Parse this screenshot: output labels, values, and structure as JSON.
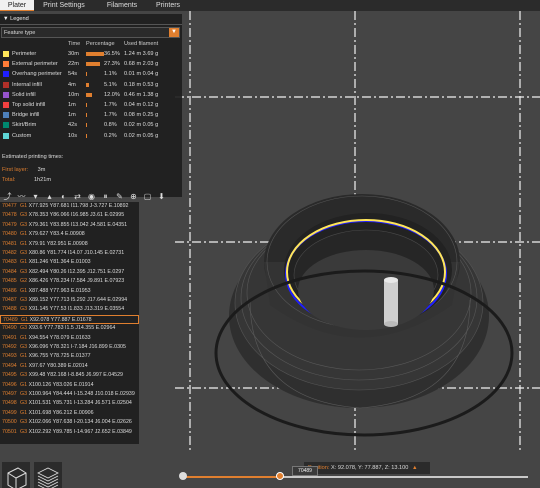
{
  "tabs": [
    {
      "label": "Plater",
      "active": true
    },
    {
      "label": "Print Settings",
      "active": false
    },
    {
      "label": "Filaments",
      "active": false
    },
    {
      "label": "Printers",
      "active": false
    }
  ],
  "legend": {
    "title": "Legend",
    "feature_select": "Feature type",
    "headers": {
      "time": "Time",
      "percentage": "Percentage",
      "used_filament": "Used filament"
    },
    "rows": [
      {
        "name": "Perimeter",
        "color": "#ffe65a",
        "time": "30m",
        "pct_value": 36.5,
        "pct": "36.5%",
        "filament": "1.24 m  3.69 g"
      },
      {
        "name": "External perimeter",
        "color": "#ff7d38",
        "time": "22m",
        "pct_value": 27.3,
        "pct": "27.3%",
        "filament": "0.68 m  2.03 g"
      },
      {
        "name": "Overhang perimeter",
        "color": "#1f1fff",
        "time": "54s",
        "pct_value": 1.1,
        "pct": "1.1%",
        "filament": "0.01 m  0.04 g"
      },
      {
        "name": "Internal infill",
        "color": "#b03029",
        "time": "4m",
        "pct_value": 5.1,
        "pct": "5.1%",
        "filament": "0.18 m  0.53 g"
      },
      {
        "name": "Solid infill",
        "color": "#9654cc",
        "time": "10m",
        "pct_value": 12.0,
        "pct": "12.0%",
        "filament": "0.46 m  1.38 g"
      },
      {
        "name": "Top solid infill",
        "color": "#f04040",
        "time": "1m",
        "pct_value": 1.7,
        "pct": "1.7%",
        "filament": "0.04 m  0.12 g"
      },
      {
        "name": "Bridge infill",
        "color": "#4d80ba",
        "time": "1m",
        "pct_value": 1.7,
        "pct": "1.7%",
        "filament": "0.08 m  0.25 g"
      },
      {
        "name": "Skirt/Brim",
        "color": "#00876e",
        "time": "42s",
        "pct_value": 0.8,
        "pct": "0.8%",
        "filament": "0.02 m  0.05 g"
      },
      {
        "name": "Custom",
        "color": "#5ed6d6",
        "time": "10s",
        "pct_value": 0.2,
        "pct": "0.2%",
        "filament": "0.02 m  0.05 g"
      }
    ],
    "estimated_title": "Estimated printing times:",
    "first_layer_label": "First layer:",
    "first_layer_value": "3m",
    "total_label": "Total:",
    "total_value": "1h21m"
  },
  "toolbar_icons": [
    "travel-icon",
    "wipe-icon",
    "retraction-icon",
    "deretraction-icon",
    "seams-icon",
    "tool-change-icon",
    "color-change-icon",
    "pause-icon",
    "custom-gcode-icon",
    "center-of-gravity-icon",
    "shells-icon",
    "tool-marker-icon"
  ],
  "gcode": [
    {
      "ln": "70477",
      "op": "G1",
      "tx": "X77.925 Y87.681 I11.798 J-3.727 E.10892"
    },
    {
      "ln": "70478",
      "op": "G3",
      "tx": "X78.353 Y86.066 I16.985 J3.61 E.02995"
    },
    {
      "ln": "70479",
      "op": "G3",
      "tx": "X79.361 Y83.855 I13.042 J4.581 E.04351"
    },
    {
      "ln": "70480",
      "op": "G1",
      "tx": "X79.627 Y83.4 E.00908"
    },
    {
      "ln": "70481",
      "op": "G1",
      "tx": "X79.91 Y82.951 E.00908"
    },
    {
      "ln": "70482",
      "op": "G3",
      "tx": "X80.86 Y81.774 I14.07 J10.145 E.02731"
    },
    {
      "ln": "70483",
      "op": "G1",
      "tx": "X81.246 Y81.364 E.01003"
    },
    {
      "ln": "70484",
      "op": "G3",
      "tx": "X82.494 Y80.26 I12.395 J12.751 E.0297"
    },
    {
      "ln": "70485",
      "op": "G2",
      "tx": "X86.426 Y78.234 I7.584 J9.891 E.07923"
    },
    {
      "ln": "70486",
      "op": "G1",
      "tx": "X87.488 Y77.963 E.01953"
    },
    {
      "ln": "70487",
      "op": "G3",
      "tx": "X89.152 Y77.713 I5.292 J17.644 E.02994"
    },
    {
      "ln": "70488",
      "op": "G3",
      "tx": "X91.145 Y77.53 I1.833 J13.319 E.03554"
    },
    {
      "ln": "70489",
      "op": "G1",
      "tx": "X92.078 Y77.887 E.01678",
      "sel": true
    },
    {
      "ln": "70490",
      "op": "G3",
      "tx": "X93.6 Y77.783 I1.5 J14.355 E.02964"
    },
    {
      "ln": "70491",
      "op": "G1",
      "tx": "X94.554 Y78.079 E.01633"
    },
    {
      "ln": "70492",
      "op": "G3",
      "tx": "X96.096 Y78.321 I-7.184 J16.899 E.0305"
    },
    {
      "ln": "70493",
      "op": "G1",
      "tx": "X96.755 Y78.725 E.01377"
    },
    {
      "ln": "70494",
      "op": "G1",
      "tx": "X97.67 Y80.389 E.02014"
    },
    {
      "ln": "70495",
      "op": "G3",
      "tx": "X99.48 Y82.168 I-8.845 J6.997 E.04529"
    },
    {
      "ln": "70496",
      "op": "G1",
      "tx": "X100.126 Y83.026 E.01914"
    },
    {
      "ln": "70497",
      "op": "G3",
      "tx": "X100.964 Y84.444 I-15.248 J10.018 E.02939"
    },
    {
      "ln": "70498",
      "op": "G3",
      "tx": "X101.531 Y85.731 I-13.284 J6.571 E.02504"
    },
    {
      "ln": "70499",
      "op": "G1",
      "tx": "X101.698 Y86.212 E.00906"
    },
    {
      "ln": "70500",
      "op": "G3",
      "tx": "X102.066 Y87.638 I-20.134 J6.004 E.02626"
    },
    {
      "ln": "70501",
      "op": "G3",
      "tx": "X102.292 Y89.785 I-14.967 J2.652 E.03849"
    }
  ],
  "position": {
    "label": "Position:",
    "value": "X: 92.078, Y: 77.887, Z: 13.100"
  },
  "layer_slider": {
    "value_label": "70489",
    "fraction": 0.28
  },
  "view_buttons": [
    {
      "name": "3d-view-icon"
    },
    {
      "name": "layers-view-icon"
    }
  ],
  "colors": {
    "accent": "#e07f2f",
    "panel": "#1e1e1e",
    "viewport": "#454545"
  }
}
